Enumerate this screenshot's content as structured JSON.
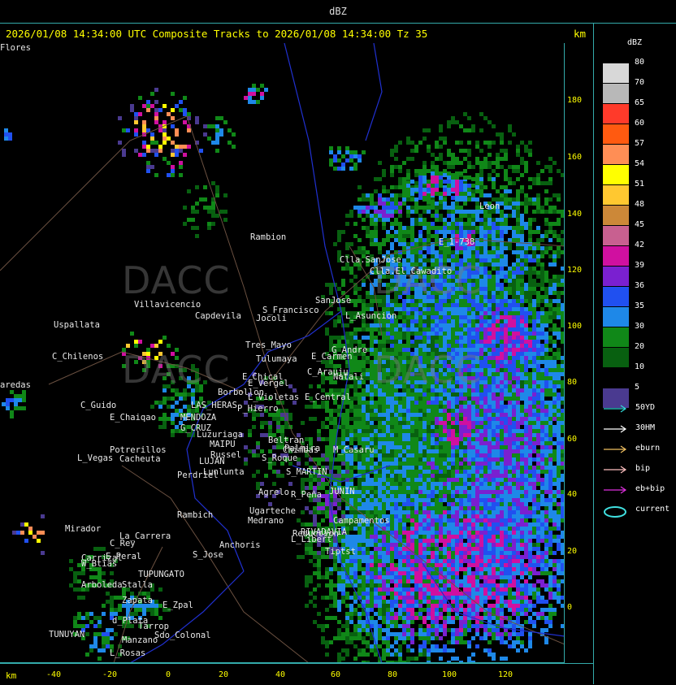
{
  "header": {
    "unit_title": "dBZ",
    "title": "2026/01/08 14:34:00 UTC Composite Tracks to 2026/01/08 14:34:00 Tz 35",
    "km_label": "km"
  },
  "y_axis": {
    "labels": [
      "180",
      "160",
      "140",
      "120",
      "100",
      "80",
      "60",
      "40",
      "20",
      "0"
    ]
  },
  "x_axis": {
    "km_label": "km",
    "labels": [
      "-40",
      "-20",
      "0",
      "20",
      "40",
      "60",
      "80",
      "100",
      "120"
    ]
  },
  "legend": {
    "title": "dBZ",
    "items": [
      {
        "label": "80",
        "color": "#d8d8d8"
      },
      {
        "label": "70",
        "color": "#b8b8b8"
      },
      {
        "label": "65",
        "color": "#ff3a2a"
      },
      {
        "label": "60",
        "color": "#ff5a10"
      },
      {
        "label": "57",
        "color": "#ff8e55"
      },
      {
        "label": "54",
        "color": "#ffff00"
      },
      {
        "label": "51",
        "color": "#ffc830"
      },
      {
        "label": "48",
        "color": "#cc8838"
      },
      {
        "label": "45",
        "color": "#c86090"
      },
      {
        "label": "42",
        "color": "#d010a0"
      },
      {
        "label": "39",
        "color": "#7a20d0"
      },
      {
        "label": "36",
        "color": "#2050f0"
      },
      {
        "label": "35",
        "color": "#1e88e8"
      },
      {
        "label": "30",
        "color": "#108818"
      },
      {
        "label": "20",
        "color": "#086010"
      },
      {
        "label": "10",
        "color": "#000000"
      },
      {
        "label": "5",
        "color": "#4a3a90"
      }
    ],
    "tracks": [
      {
        "label": "50YD",
        "color": "#30d8d8"
      },
      {
        "label": "30HM",
        "color": "#ffffff"
      },
      {
        "label": "eburn",
        "color": "#f0c060"
      },
      {
        "label": "bip",
        "color": "#ffc0c0"
      },
      {
        "label": "eb+bip",
        "color": "#e030e0"
      },
      {
        "label": "current",
        "color": "#40e0e0"
      }
    ]
  },
  "map": {
    "watermark": "DACC",
    "places": [
      "Rambion",
      "Clla.SanJose",
      "Clla.El_Cawadito",
      "E_1-738",
      "Leon",
      "S_Francisco",
      "Jocoli",
      "SanJose",
      "L_Asuncion",
      "Villavicencio",
      "Uspallata",
      "Capdevila",
      "Tres_Mayo",
      "Tulumaya",
      "E_Carmen",
      "G_Andre",
      "C_Chilenos",
      "E_Chical",
      "E_Vergel",
      "C_Arauju",
      "Natali",
      "aredas",
      "L_Violetas",
      "Borbollon",
      "P_Hierro",
      "E_Central",
      "C_Guido",
      "E_Chaiqao",
      "LAS_HERAS",
      "MENDOZA",
      "G_CRUZ",
      "Luzuriaga",
      "Beltran",
      "Palmira",
      "Chimbas",
      "M_Casaru",
      "S_Roque",
      "Russel",
      "MAIPU",
      "Potrerillos",
      "L_Vegas",
      "Cacheuta",
      "LUJAN",
      "Lunlunta",
      "Perdriel",
      "S_MARTIN",
      "Agrelo",
      "R_Peña",
      "JUNIN",
      "Rambich",
      "Ugarteche",
      "Medrano",
      "Reduccion",
      "RIVADAVIA",
      "L_Libert",
      "Campamentos",
      "Tiptst",
      "Mirador",
      "La_Carrera",
      "C_Rey",
      "S_Jose",
      "Anchoris",
      "Carrizal",
      "E_Peral",
      "W_Btias",
      "TUPUNGATO",
      "Arboleda",
      "Stalla",
      "E_Zpal",
      "Zapata",
      "d_Plata",
      "Tarrop",
      "Sdo_Colonal",
      "TUNUYAN",
      "Manzano",
      "L_Rosas",
      "Flores"
    ]
  }
}
